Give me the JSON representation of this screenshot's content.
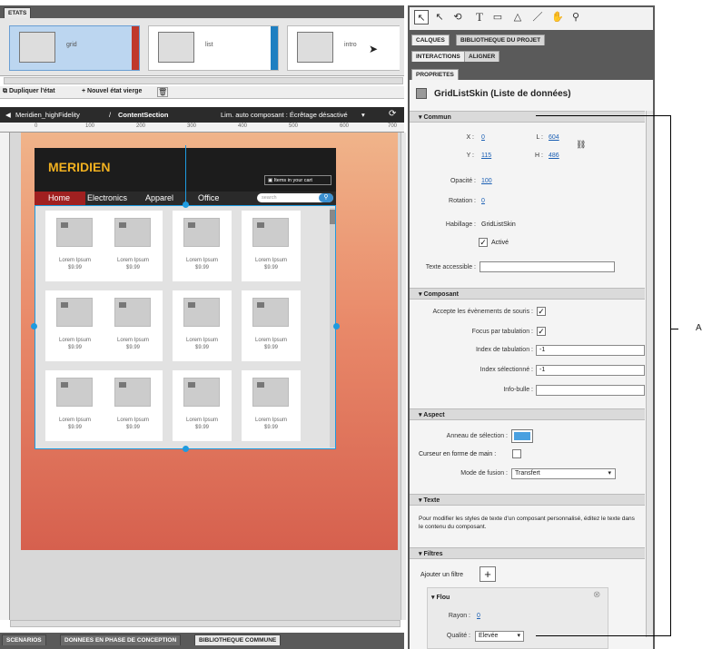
{
  "states": {
    "tab": "ETATS",
    "cards": [
      {
        "label": "grid",
        "color": "#c0392b"
      },
      {
        "label": "list",
        "color": "#1e7fc1"
      },
      {
        "label": "intro",
        "color": "#ffffff"
      }
    ],
    "duplicate": "Dupliquer l'état",
    "new_blank": "+ Nouvel état vierge"
  },
  "breadcrumb": {
    "file": "Meridien_highFidelity",
    "sep": "/",
    "section": "ContentSection",
    "info": "Lim. auto composant : Écrêtage désactivé"
  },
  "ruler": [
    "0",
    "100",
    "200",
    "300",
    "400",
    "500",
    "600",
    "700"
  ],
  "store": {
    "brand": "MERIDIEN",
    "cart": "Items in your cart",
    "nav": [
      "Home",
      "Electronics",
      "Apparel",
      "Office"
    ],
    "search_placeholder": "search",
    "items": [
      {
        "name": "Lorem Ipsum",
        "price": "$9.99"
      },
      {
        "name": "Lorem Ipsum",
        "price": "$9.99"
      },
      {
        "name": "Lorem Ipsum",
        "price": "$9.99"
      },
      {
        "name": "Lorem Ipsum",
        "price": "$9.99"
      },
      {
        "name": "Lorem Ipsum",
        "price": "$9.99"
      },
      {
        "name": "Lorem Ipsum",
        "price": "$9.99"
      },
      {
        "name": "Lorem Ipsum",
        "price": "$9.99"
      },
      {
        "name": "Lorem Ipsum",
        "price": "$9.99"
      },
      {
        "name": "Lorem Ipsum",
        "price": "$9.99"
      },
      {
        "name": "Lorem Ipsum",
        "price": "$9.99"
      },
      {
        "name": "Lorem Ipsum",
        "price": "$9.99"
      },
      {
        "name": "Lorem Ipsum",
        "price": "$9.99"
      }
    ]
  },
  "bottom_tabs": [
    "SCENARIOS",
    "DONNEES EN PHASE DE CONCEPTION",
    "BIBLIOTHEQUE COMMUNE"
  ],
  "panel_tabs": {
    "row1": [
      "CALQUES",
      "BIBLIOTHEQUE DU PROJET"
    ],
    "row2": [
      "INTERACTIONS",
      "ALIGNER"
    ],
    "row3": [
      "PROPRIETES"
    ]
  },
  "tools": [
    "select-arrow-icon",
    "direct-select-icon",
    "rotate-icon",
    "text-tool-icon",
    "rectangle-tool-icon",
    "triangle-tool-icon",
    "line-tool-icon",
    "hand-tool-icon",
    "zoom-tool-icon"
  ],
  "props": {
    "title": "GridListSkin (Liste de données)",
    "common": {
      "header": "Commun",
      "x_label": "X :",
      "x": "0",
      "y_label": "Y :",
      "y": "115",
      "w_label": "L :",
      "w": "604",
      "h_label": "H :",
      "h": "486",
      "opacity_label": "Opacité :",
      "opacity": "100",
      "rotation_label": "Rotation :",
      "rotation": "0",
      "skin_label": "Habillage :",
      "skin": "GridListSkin",
      "active_label": "Activé",
      "access_label": "Texte accessible :",
      "access": ""
    },
    "component": {
      "header": "Composant",
      "mouse_label": "Accepte les évènements de souris :",
      "tab_focus_label": "Focus par tabulation :",
      "tab_index_label": "Index de tabulation :",
      "tab_index": "-1",
      "sel_index_label": "Index sélectionné :",
      "sel_index": "-1",
      "tooltip_label": "Info-bulle :",
      "tooltip": ""
    },
    "aspect": {
      "header": "Aspect",
      "ring_label": "Anneau de sélection :",
      "ring_color": "#4aa0e0",
      "hand_label": "Curseur en forme de main :",
      "blend_label": "Mode de fusion :",
      "blend": "Transfert"
    },
    "text": {
      "header": "Texte",
      "desc": "Pour modifier les styles de texte d'un composant personnalisé, éditez le texte dans le contenu du composant."
    },
    "filters": {
      "header": "Filtres",
      "add_label": "Ajouter un filtre",
      "blur": "Flou",
      "radius_label": "Rayon :",
      "radius": "0",
      "quality_label": "Qualité :",
      "quality": "Elevée"
    }
  },
  "callout": "A"
}
